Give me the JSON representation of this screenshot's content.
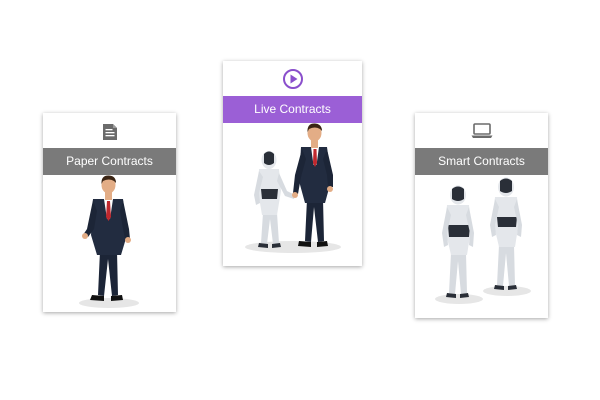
{
  "colors": {
    "header_gray": "#7a7a7a",
    "header_purple": "#9b5fd6",
    "icon_gray": "#6b6b6b",
    "icon_purple": "#8a4fcc"
  },
  "cards": [
    {
      "label": "Paper Contracts",
      "icon": "document-icon",
      "figure": "businessman"
    },
    {
      "label": "Live Contracts",
      "icon": "play-circle-icon",
      "figure": "robot-handshake-businessman"
    },
    {
      "label": "Smart Contracts",
      "icon": "laptop-icon",
      "figure": "two-robots"
    }
  ]
}
